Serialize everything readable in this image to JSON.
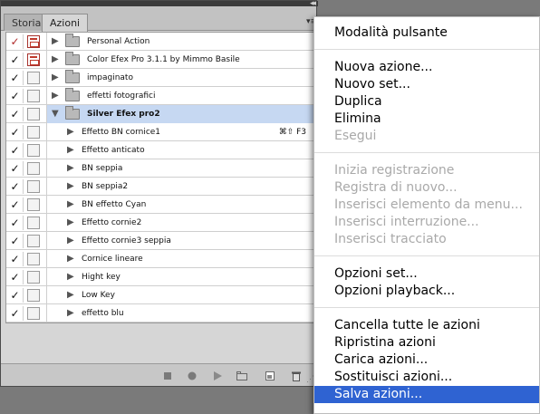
{
  "panel": {
    "tabs": [
      "Storia",
      "Azioni"
    ],
    "collapse_glyph": "◂◂",
    "menu_glyph": "▾≡",
    "rows": [
      {
        "type": "set",
        "label": "Personal Action",
        "check": "✓",
        "dialog": true,
        "expanded": false,
        "selected": false,
        "check_red": true
      },
      {
        "type": "set",
        "label": "Color Efex Pro 3.1.1 by Mimmo Basile",
        "check": "✓",
        "dialog": true,
        "expanded": false,
        "selected": false
      },
      {
        "type": "set",
        "label": "impaginato",
        "check": "✓",
        "dialog": false,
        "expanded": false,
        "selected": false
      },
      {
        "type": "set",
        "label": "effetti fotografici",
        "check": "✓",
        "dialog": false,
        "expanded": false,
        "selected": false
      },
      {
        "type": "set",
        "label": "Silver Efex pro2",
        "check": "✓",
        "dialog": false,
        "expanded": true,
        "selected": true
      },
      {
        "type": "action",
        "label": "Effetto BN cornice1",
        "check": "✓",
        "dialog": false,
        "shortcut": "⌘⇧ F3"
      },
      {
        "type": "action",
        "label": "Effetto anticato",
        "check": "✓",
        "dialog": false
      },
      {
        "type": "action",
        "label": "BN seppia",
        "check": "✓",
        "dialog": false
      },
      {
        "type": "action",
        "label": "BN seppia2",
        "check": "✓",
        "dialog": false
      },
      {
        "type": "action",
        "label": "BN effetto Cyan",
        "check": "✓",
        "dialog": false
      },
      {
        "type": "action",
        "label": "Effetto cornie2",
        "check": "✓",
        "dialog": false
      },
      {
        "type": "action",
        "label": "Effetto cornie3 seppia",
        "check": "✓",
        "dialog": false
      },
      {
        "type": "action",
        "label": "Cornice lineare",
        "check": "✓",
        "dialog": false
      },
      {
        "type": "action",
        "label": "Hight key",
        "check": "✓",
        "dialog": false
      },
      {
        "type": "action",
        "label": "Low Key",
        "check": "✓",
        "dialog": false
      },
      {
        "type": "action",
        "label": "effetto blu",
        "check": "✓",
        "dialog": false
      }
    ],
    "bottom_icons": [
      "stop-icon",
      "record-icon",
      "play-icon",
      "new-set-icon",
      "new-action-icon",
      "trash-icon"
    ]
  },
  "menu": {
    "items": [
      {
        "label": "Modalità pulsante",
        "disabled": false
      },
      {
        "sep": true
      },
      {
        "label": "Nuova azione...",
        "disabled": false
      },
      {
        "label": "Nuovo set...",
        "disabled": false
      },
      {
        "label": "Duplica",
        "disabled": false
      },
      {
        "label": "Elimina",
        "disabled": false
      },
      {
        "label": "Esegui",
        "disabled": true
      },
      {
        "sep": true
      },
      {
        "label": "Inizia registrazione",
        "disabled": true
      },
      {
        "label": "Registra di nuovo...",
        "disabled": true
      },
      {
        "label": "Inserisci elemento da menu...",
        "disabled": true
      },
      {
        "label": "Inserisci interruzione...",
        "disabled": true
      },
      {
        "label": "Inserisci tracciato",
        "disabled": true
      },
      {
        "sep": true
      },
      {
        "label": "Opzioni set...",
        "disabled": false
      },
      {
        "label": "Opzioni playback...",
        "disabled": false
      },
      {
        "sep": true
      },
      {
        "label": "Cancella tutte le azioni",
        "disabled": false
      },
      {
        "label": "Ripristina azioni",
        "disabled": false
      },
      {
        "label": "Carica azioni...",
        "disabled": false
      },
      {
        "label": "Sostituisci azioni...",
        "disabled": false
      },
      {
        "label": "Salva azioni...",
        "disabled": false,
        "highlighted": true
      }
    ]
  }
}
